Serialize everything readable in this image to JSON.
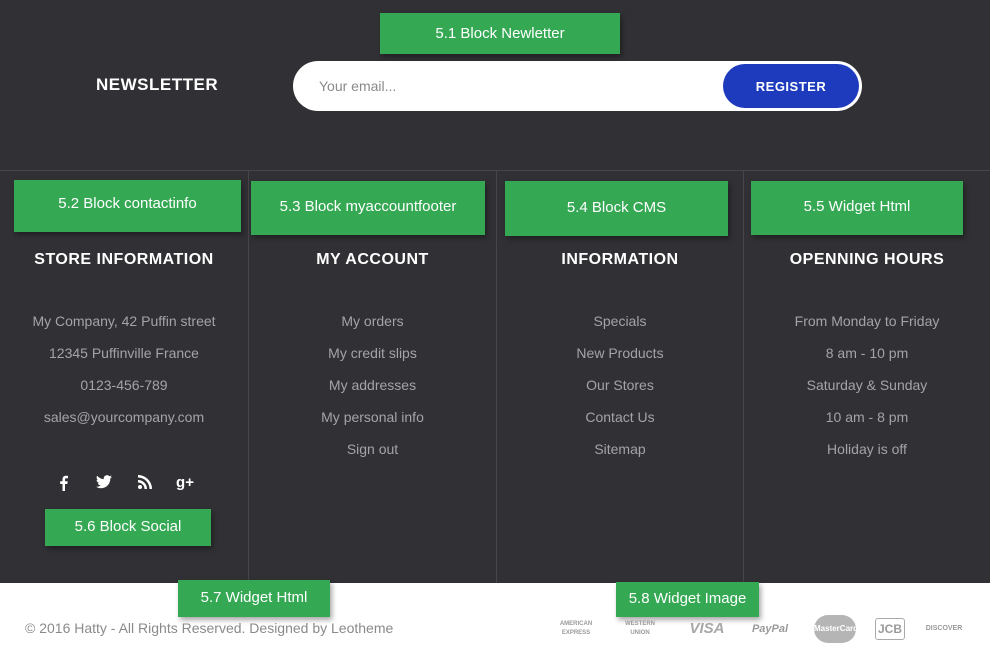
{
  "newsletter": {
    "title": "NEWSLETTER",
    "placeholder": "Your email...",
    "button": "REGISTER"
  },
  "columns": [
    {
      "title": "STORE INFORMATION",
      "items": [
        "My Company, 42 Puffin street",
        "12345 Puffinville France",
        "0123-456-789",
        "sales@yourcompany.com"
      ]
    },
    {
      "title": "MY ACCOUNT",
      "items": [
        "My orders",
        "My credit slips",
        "My addresses",
        "My personal info",
        "Sign out"
      ]
    },
    {
      "title": "INFORMATION",
      "items": [
        "Specials",
        "New Products",
        "Our Stores",
        "Contact Us",
        "Sitemap"
      ]
    },
    {
      "title": "OPENNING HOURS",
      "items": [
        "From Monday to Friday",
        "8 am - 10 pm",
        "Saturday & Sunday",
        "10 am - 8 pm",
        "Holiday is off"
      ]
    }
  ],
  "social": {
    "icons": [
      "facebook-icon",
      "twitter-icon",
      "rss-icon",
      "google-plus-icon"
    ],
    "gplus_glyph": "g+"
  },
  "annotations": [
    "5.1 Block Newletter",
    "5.2 Block contactinfo",
    "5.3 Block myaccountfooter",
    "5.4 Block CMS",
    "5.5 Widget Html",
    "5.6 Block Social",
    "5.7 Widget Html",
    "5.8 Widget Image"
  ],
  "bottom": {
    "copyright": "© 2016 Hatty - All Rights Reserved. Designed by Leotheme"
  },
  "payments": [
    "AMERICAN EXPRESS",
    "WESTERN UNION",
    "VISA",
    "PayPal",
    "MasterCard",
    "JCB",
    "DISCOVER"
  ],
  "colors": {
    "footer_bg": "#313135",
    "accent_button": "#1e3bbd",
    "annotation": "#34a853"
  }
}
